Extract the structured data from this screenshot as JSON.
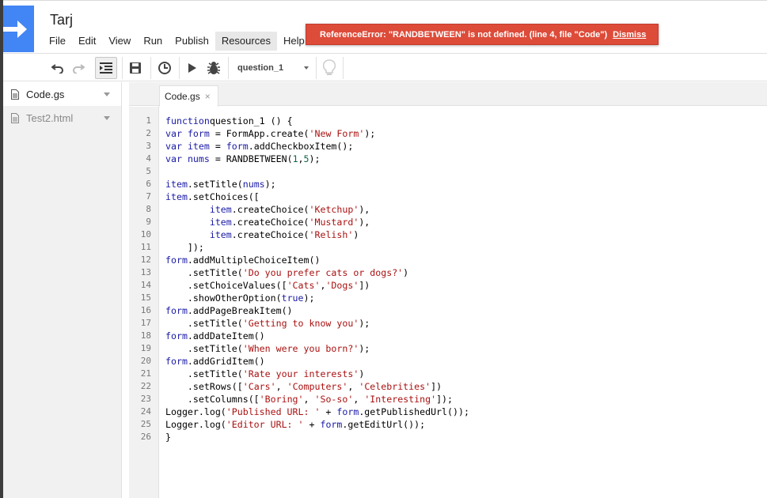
{
  "app": {
    "doc_title": "Tarj"
  },
  "menu": [
    "File",
    "Edit",
    "View",
    "Run",
    "Publish",
    "Resources",
    "Help"
  ],
  "error": {
    "message": "ReferenceError: \"RANDBETWEEN\" is not defined. (line 4, file \"Code\")",
    "dismiss": "Dismiss"
  },
  "toolbar": {
    "function_selected": "question_1",
    "icons": [
      "undo-icon",
      "redo-icon",
      "indent-icon",
      "save-icon",
      "triggers-clock-icon",
      "run-icon",
      "debug-bug-icon",
      "lightbulb-icon"
    ]
  },
  "files": [
    {
      "name": "Code.gs",
      "selected": true
    },
    {
      "name": "Test2.html",
      "selected": false
    }
  ],
  "editor": {
    "tab": "Code.gs",
    "lines": [
      [
        [
          "kw",
          "function"
        ],
        [
          "",
          "question_1 () {"
        ]
      ],
      [
        [
          "kw",
          "var"
        ],
        [
          "",
          " "
        ],
        [
          "var",
          "form"
        ],
        [
          "",
          " = FormApp.create("
        ],
        [
          "str",
          "'New Form'"
        ],
        [
          "",
          ");"
        ]
      ],
      [
        [
          "kw",
          "var"
        ],
        [
          "",
          " "
        ],
        [
          "var",
          "item"
        ],
        [
          "",
          " = "
        ],
        [
          "var",
          "form"
        ],
        [
          "",
          ".addCheckboxItem();"
        ]
      ],
      [
        [
          "kw",
          "var"
        ],
        [
          "",
          " "
        ],
        [
          "var",
          "nums"
        ],
        [
          "",
          " = RANDBETWEEN("
        ],
        [
          "num",
          "1"
        ],
        [
          "",
          ","
        ],
        [
          "num",
          "5"
        ],
        [
          "",
          ");"
        ]
      ],
      [],
      [
        [
          "var",
          "item"
        ],
        [
          "",
          ".setTitle("
        ],
        [
          "var",
          "nums"
        ],
        [
          "",
          ");"
        ]
      ],
      [
        [
          "var",
          "item"
        ],
        [
          "",
          ".setChoices(["
        ]
      ],
      [
        [
          "",
          "        "
        ],
        [
          "var",
          "item"
        ],
        [
          "",
          ".createChoice("
        ],
        [
          "str",
          "'Ketchup'"
        ],
        [
          "",
          "),"
        ]
      ],
      [
        [
          "",
          "        "
        ],
        [
          "var",
          "item"
        ],
        [
          "",
          ".createChoice("
        ],
        [
          "str",
          "'Mustard'"
        ],
        [
          "",
          "),"
        ]
      ],
      [
        [
          "",
          "        "
        ],
        [
          "var",
          "item"
        ],
        [
          "",
          ".createChoice("
        ],
        [
          "str",
          "'Relish'"
        ],
        [
          "",
          ")"
        ]
      ],
      [
        [
          "",
          "    ]);"
        ]
      ],
      [
        [
          "var",
          "form"
        ],
        [
          "",
          ".addMultipleChoiceItem()"
        ]
      ],
      [
        [
          "",
          "    .setTitle("
        ],
        [
          "str",
          "'Do you prefer cats or dogs?'"
        ],
        [
          "",
          ")"
        ]
      ],
      [
        [
          "",
          "    .setChoiceValues(["
        ],
        [
          "str",
          "'Cats'"
        ],
        [
          "",
          ","
        ],
        [
          "str",
          "'Dogs'"
        ],
        [
          "",
          "])"
        ]
      ],
      [
        [
          "",
          "    .showOtherOption("
        ],
        [
          "kw",
          "true"
        ],
        [
          "",
          ");"
        ]
      ],
      [
        [
          "var",
          "form"
        ],
        [
          "",
          ".addPageBreakItem()"
        ]
      ],
      [
        [
          "",
          "    .setTitle("
        ],
        [
          "str",
          "'Getting to know you'"
        ],
        [
          "",
          ");"
        ]
      ],
      [
        [
          "var",
          "form"
        ],
        [
          "",
          ".addDateItem()"
        ]
      ],
      [
        [
          "",
          "    .setTitle("
        ],
        [
          "str",
          "'When were you born?'"
        ],
        [
          "",
          ");"
        ]
      ],
      [
        [
          "var",
          "form"
        ],
        [
          "",
          ".addGridItem()"
        ]
      ],
      [
        [
          "",
          "    .setTitle("
        ],
        [
          "str",
          "'Rate your interests'"
        ],
        [
          "",
          ")"
        ]
      ],
      [
        [
          "",
          "    .setRows(["
        ],
        [
          "str",
          "'Cars'"
        ],
        [
          "",
          ", "
        ],
        [
          "str",
          "'Computers'"
        ],
        [
          "",
          ", "
        ],
        [
          "str",
          "'Celebrities'"
        ],
        [
          "",
          "])"
        ]
      ],
      [
        [
          "",
          "    .setColumns(["
        ],
        [
          "str",
          "'Boring'"
        ],
        [
          "",
          ", "
        ],
        [
          "str",
          "'So-so'"
        ],
        [
          "",
          ", "
        ],
        [
          "str",
          "'Interesting'"
        ],
        [
          "",
          "]);"
        ]
      ],
      [
        [
          "",
          "Logger.log("
        ],
        [
          "str",
          "'Published URL: '"
        ],
        [
          "",
          " + "
        ],
        [
          "var",
          "form"
        ],
        [
          "",
          ".getPublishedUrl());"
        ]
      ],
      [
        [
          "",
          "Logger.log("
        ],
        [
          "str",
          "'Editor URL: '"
        ],
        [
          "",
          " + "
        ],
        [
          "var",
          "form"
        ],
        [
          "",
          ".getEditUrl());"
        ]
      ],
      [
        [
          "",
          "}"
        ]
      ]
    ]
  }
}
